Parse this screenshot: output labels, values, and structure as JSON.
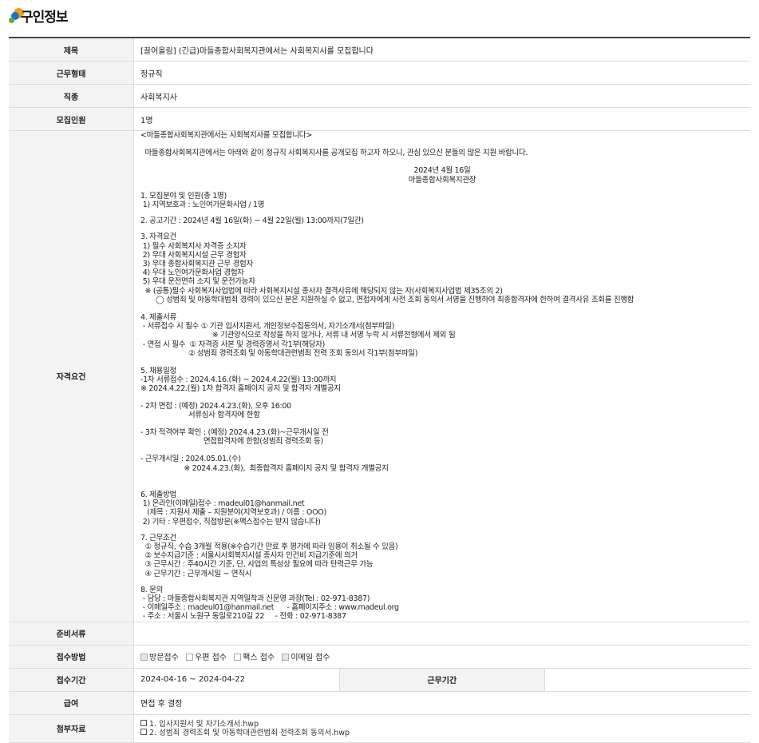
{
  "page_title": "구인정보",
  "rows": {
    "subject": {
      "label": "제목",
      "value": "[끌어올림] (긴급)마들종합사회복지관에서는 사회복지사를 모집합니다"
    },
    "employment_type": {
      "label": "근무형태",
      "value": "정규직"
    },
    "job_type": {
      "label": "직종",
      "value": "사회복지사"
    },
    "headcount": {
      "label": "모집인원",
      "value": "1명"
    },
    "qualifications": {
      "label": "자격요건"
    },
    "documents": {
      "label": "준비서류",
      "value": ""
    },
    "apply_method": {
      "label": "접수방법",
      "options": [
        "방문접수",
        "우편 접수",
        "팩스 접수",
        "이메일 접수"
      ]
    },
    "apply_period": {
      "label": "접수기간",
      "value": "2024-04-16 ~ 2024-04-22",
      "work_label": "근무기간",
      "work_value": ""
    },
    "salary": {
      "label": "급여",
      "value": "면접 후 결정"
    },
    "attachments": {
      "label": "첨부자료",
      "files": [
        "1. 입사지원서 및 자기소개서.hwp",
        "2. 성범죄 경력조회 및 아동학대관련범죄 전력조회 동의서.hwp"
      ]
    }
  },
  "content_lines": [
    {
      "t": "<마들종합사회복지관에서는 사회복지사를 모집합니다>",
      "gap": 0
    },
    {
      "t": "  마들종합사회복지관에서는 아래와 같이 정규직 사회복지사를 공개모집 하고자 하오니, 관심 있으신 분들의 많은 지원 바랍니다.",
      "gap": 11
    },
    {
      "t": "2024년 4월 16일",
      "gap": 11,
      "center": true
    },
    {
      "t": "마들종합사회복지관장",
      "gap": 0,
      "center": true
    },
    {
      "t": "1. 모집분야 및 인원(총 1명)",
      "gap": 9
    },
    {
      "t": " 1) 지역보호과 : 노인여가문화사업 / 1명",
      "gap": 0
    },
    {
      "t": "2. 공고기간 : 2024년 4월 16일(화) ~ 4월 22일(월) 13:00까지(7일간)",
      "gap": 9
    },
    {
      "t": "3. 자격요건",
      "gap": 9
    },
    {
      "t": " 1) 필수 사회복지사 자격증 소지자",
      "gap": 0
    },
    {
      "t": " 2) 우대 사회복지시설 근무 경험자",
      "gap": 0
    },
    {
      "t": " 3) 우대 종합사회복지관 근무 경험자",
      "gap": 0
    },
    {
      "t": " 4) 우대 노인여가문화사업 경험자",
      "gap": 0
    },
    {
      "t": " 5) 우대 운전면허 소지 및 운전가능자",
      "gap": 0
    },
    {
      "t": "  ※ (공통)필수 사회복지사업법에 따라 사회복지시설 종사자 결격사유에 해당되지 않는 자(사회복지사업법 제35조의 2)",
      "gap": 0
    },
    {
      "t": "       ◯ 성범죄 및 아동학대범죄 경력이 있으신 분은 지원하실 수 없고, 면접자에게 사전 조회 동의서 서명을 진행하여 최종합격자에 한하여 결격사유 조회를 진행함",
      "gap": 0
    },
    {
      "t": "4. 제출서류",
      "gap": 11
    },
    {
      "t": " - 서류접수 시 필수 ① 기관 입사지원서, 개인정보수집동의서, 자기소개서(첨부파일)",
      "gap": 0
    },
    {
      "t": "                                 ※ 기관양식으로 작성을 하지 않거나, 서류 내 서명 누락 시 서류전형에서 제외 됨",
      "gap": 0
    },
    {
      "t": " - 면접 시 필수  ① 자격증 사본 및 경력증명서 각1부(해당자)",
      "gap": 0
    },
    {
      "t": "                      ② 성범죄 경력조회 및 아동학대관련범죄 전력 조회 동의서 각1부(첨부파일)",
      "gap": 0
    },
    {
      "t": "5. 채용일정",
      "gap": 11
    },
    {
      "t": "-1차 서류접수 : 2024.4.16.(화) ~ 2024.4.22(월) 13:00까지",
      "gap": 0
    },
    {
      "t": "※ 2024.4.22.(월) 1차 합격자 홈페이지 공지 및 합격자 개별공지",
      "gap": 0
    },
    {
      "t": "- 2차 면접 : (예정) 2024.4.23.(화), 오후 16:00",
      "gap": 10
    },
    {
      "t": "                      서류심사 합격자에 한함",
      "gap": 0
    },
    {
      "t": "- 3차 적격여부 확인 : (예정) 2024.4.23.(화)~근무개시일 전",
      "gap": 11
    },
    {
      "t": "                             면접합격자에 한함(성범죄 경력조회 등)",
      "gap": 0
    },
    {
      "t": "- 근무개시일 : 2024.05.01.(수)",
      "gap": 11
    },
    {
      "t": "                    ※ 2024.4.23.(화),  최종합격자 홈페이지 공지 및 합격자 개별공지",
      "gap": 0
    },
    {
      "t": "6. 제출방법",
      "gap": 22
    },
    {
      "t": " 1) 온라인(이메일)접수 : madeul01@hanmail.net",
      "gap": 0
    },
    {
      "t": "   (제목 : 지원서 제출 – 지원분야(지역보호과) / 이름 : OOO)",
      "gap": 0
    },
    {
      "t": " 2) 기타 : 우편접수, 직접방문(※팩스접수는 받지 않습니다)",
      "gap": 0
    },
    {
      "t": "7. 근무조건",
      "gap": 9
    },
    {
      "t": "  ① 정규직, 수습 3개월 적용(※수습기간 만료 후 평가에 따라 임용이 취소될 수 있음)",
      "gap": 0
    },
    {
      "t": "  ② 보수지급기준 : 서울시사회복지시설 종사자 인건비 지급기준에 의거",
      "gap": 0
    },
    {
      "t": "  ③ 근무시간 : 주40시간 기준, 단, 사업의 특성상 필요에 따라 탄력근무 가능",
      "gap": 0
    },
    {
      "t": "  ④ 근무기간 : 근무개시일 ~ 면직시",
      "gap": 0
    },
    {
      "t": "8. 문의",
      "gap": 9
    },
    {
      "t": " - 담당 : 마들종합사회복지관 지역밀착과 신문영 과장(Tel : 02-971-8387)",
      "gap": 0
    },
    {
      "t": " - 이메일주소 : madeul01@hanmail.net      - 홈페이지주소 : www.madeul.org",
      "gap": 0
    },
    {
      "t": " - 주소 : 서울시 노원구 동일로210길 22     - 전화 : 02-971-8387",
      "gap": 0
    }
  ]
}
